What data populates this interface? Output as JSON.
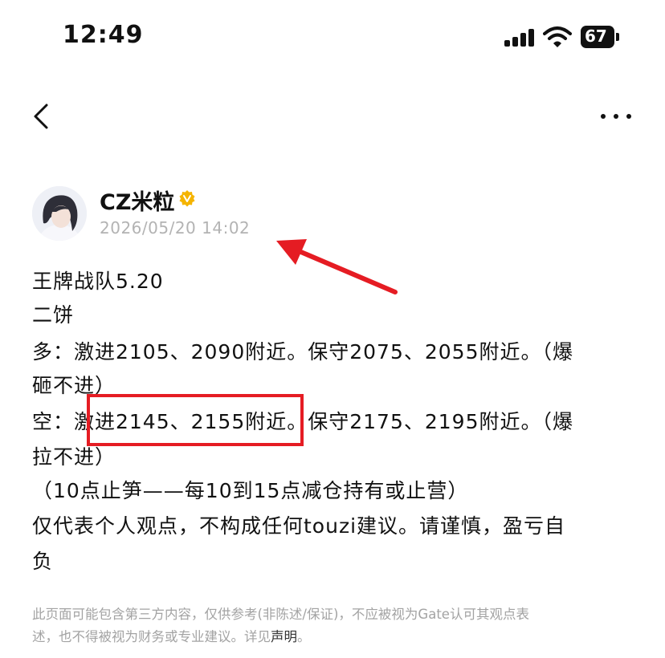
{
  "status_bar": {
    "time": "12:49",
    "battery": "67"
  },
  "nav": {
    "back_icon": "chevron-left-icon",
    "more_icon": "more-horizontal-icon"
  },
  "author": {
    "name": "CZ米粒",
    "verified_badge": "verified-badge-icon",
    "timestamp": "2026/05/20 14:02"
  },
  "post": {
    "lines": [
      "王牌战队5.20",
      "二饼",
      "多：激进2105、2090附近。保守2075、2055附近。（爆",
      "砸不进）",
      "空：激进2145、2155附近。保守2175、2195附近。（爆",
      "拉不进）",
      "（10点止笋——每10到15点减仓持有或止营）",
      "仅代表个人观点，不构成任何touzi建议。请谨慎，盈亏自",
      "负"
    ]
  },
  "disclaimer": {
    "line1": "此页面可能包含第三方内容，仅供参考(非陈述/保证)，不应被视为Gate认可其观点表",
    "line2_prefix": "述，也不得被视为财务或专业建议。详见",
    "line2_link": "声明",
    "line2_suffix": "。"
  },
  "colors": {
    "annotation_red": "#e51c23",
    "verified_gold": "#f5b400",
    "timestamp_gray": "#b3b3b3"
  }
}
